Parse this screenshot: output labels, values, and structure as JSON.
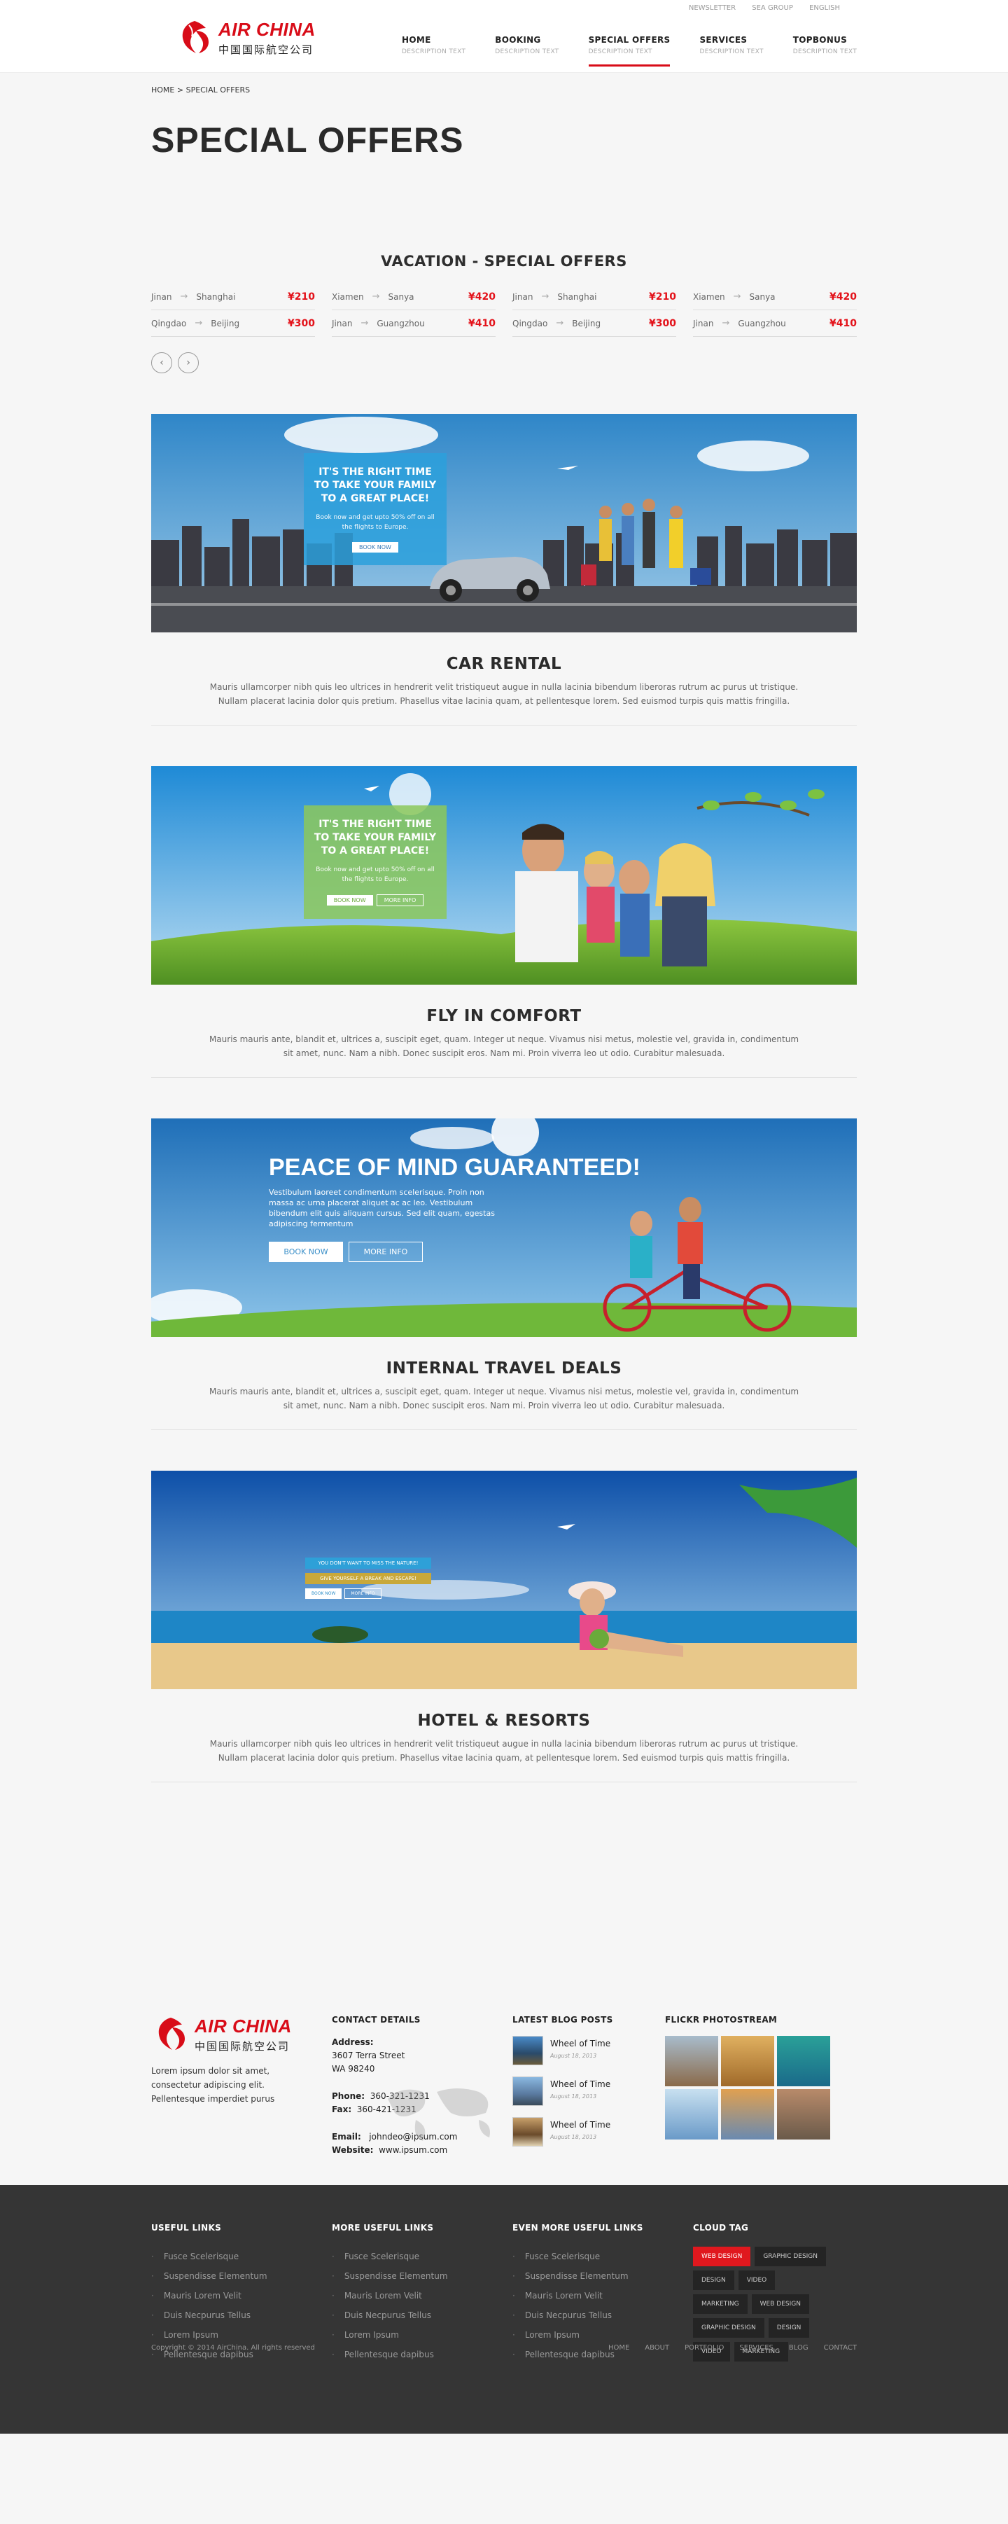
{
  "topbar": {
    "links": [
      "NEWSLETTER",
      "SEA GROUP",
      "ENGLISH"
    ]
  },
  "logo": {
    "en": "AIR CHINA",
    "cn": "中国国际航空公司"
  },
  "nav": [
    {
      "title": "HOME",
      "sub": "DESCRIPTION TEXT"
    },
    {
      "title": "BOOKING",
      "sub": "DESCRIPTION TEXT"
    },
    {
      "title": "SPECIAL OFFERS",
      "sub": "DESCRIPTION TEXT"
    },
    {
      "title": "SERVICES",
      "sub": "DESCRIPTION TEXT"
    },
    {
      "title": "TOPBONUS",
      "sub": "DESCRIPTION TEXT"
    }
  ],
  "breadcrumb": "HOME > SPECIAL OFFERS",
  "page_title": "SPECIAL OFFERS",
  "offers": {
    "title": "VACATION - SPECIAL OFFERS",
    "items": [
      {
        "from": "Jinan",
        "to": "Shanghai",
        "price": "¥210"
      },
      {
        "from": "Xiamen",
        "to": "Sanya",
        "price": "¥420"
      },
      {
        "from": "Jinan",
        "to": "Shanghai",
        "price": "¥210"
      },
      {
        "from": "Xiamen",
        "to": "Sanya",
        "price": "¥420"
      },
      {
        "from": "Qingdao",
        "to": "Beijing",
        "price": "¥300"
      },
      {
        "from": "Jinan",
        "to": "Guangzhou",
        "price": "¥410"
      },
      {
        "from": "Qingdao",
        "to": "Beijing",
        "price": "¥300"
      },
      {
        "from": "Jinan",
        "to": "Guangzhou",
        "price": "¥410"
      }
    ],
    "prev_icon": "‹",
    "next_icon": "›"
  },
  "services": [
    {
      "title": "CAR RENTAL",
      "text": "Mauris ullamcorper nibh quis leo ultrices in hendrerit velit tristiqueut augue in nulla lacinia bibendum liberoras rutrum ac purus ut tristique. Nullam placerat lacinia dolor quis pretium. Phasellus vitae lacinia quam, at pellentesque lorem. Sed euismod turpis quis mattis fringilla.",
      "promo_title": "IT'S THE RIGHT TIME TO TAKE YOUR FAMILY TO A GREAT PLACE!",
      "promo_text": "Book now and get upto 50% off on all the flights to Europe.",
      "promo_button": "BOOK NOW"
    },
    {
      "title": "FLY IN COMFORT",
      "text": "Mauris mauris ante, blandit et, ultrices a, suscipit eget, quam. Integer ut neque. Vivamus nisi metus, molestie vel, gravida in, condimentum sit amet, nunc. Nam a nibh. Donec suscipit eros. Nam mi. Proin viverra leo ut odio. Curabitur malesuada.",
      "promo_title": "IT'S THE RIGHT TIME TO TAKE YOUR FAMILY TO A GREAT PLACE!",
      "promo_text": "Book now and get upto 50% off on all the flights to Europe.",
      "promo_button": "BOOK NOW",
      "promo_button2": "MORE INFO"
    },
    {
      "title": "INTERNAL TRAVEL DEALS",
      "text": "Mauris mauris ante, blandit et, ultrices a, suscipit eget, quam. Integer ut neque. Vivamus nisi metus, molestie vel, gravida in, condimentum sit amet, nunc. Nam a nibh. Donec suscipit eros. Nam mi. Proin viverra leo ut odio. Curabitur malesuada.",
      "promo_title": "PEACE OF MIND GUARANTEED!",
      "promo_text": "Vestibulum laoreet condimentum scelerisque. Proin non massa ac urna placerat aliquet ac ac leo. Vestibulum bibendum elit quis aliquam cursus. Sed elit quam, egestas adipiscing fermentum",
      "promo_button": "BOOK NOW",
      "promo_button2": "MORE INFO"
    },
    {
      "title": "HOTEL & RESORTS",
      "text": "Mauris ullamcorper nibh quis leo ultrices in hendrerit velit tristiqueut augue in nulla lacinia bibendum liberoras rutrum ac purus ut tristique. Nullam placerat lacinia dolor quis pretium. Phasellus vitae lacinia quam, at pellentesque lorem. Sed euismod turpis quis mattis fringilla.",
      "promo_title": "YOU DON'T WANT TO MISS THE NATURE!",
      "promo_text": "GIVE YOURSELF A BREAK AND ESCAPE!",
      "promo_button": "BOOK NOW",
      "promo_button2": "MORE INFO"
    }
  ],
  "footer": {
    "about": "Lorem ipsum dolor sit amet, consectetur adipiscing elit. Pellentesque imperdiet purus",
    "contact": {
      "title": "CONTACT DETAILS",
      "address_label": "Address:",
      "address1": "3607 Terra Street",
      "address2": "WA 98240",
      "phone_label": "Phone:",
      "phone": "360-321-1231",
      "fax_label": "Fax:",
      "fax": "360-421-1231",
      "email_label": "Email:",
      "email": "johndeo@ipsum.com",
      "website_label": "Website:",
      "website": "www.ipsum.com"
    },
    "blog": {
      "title": "LATEST BLOG POSTS",
      "posts": [
        {
          "title": "Wheel of Time",
          "date": "August 18, 2013"
        },
        {
          "title": "Wheel of Time",
          "date": "August 18, 2013"
        },
        {
          "title": "Wheel of Time",
          "date": "August 18, 2013"
        }
      ]
    },
    "flickr": {
      "title": "FLICKR PHOTOSTREAM"
    },
    "links": [
      {
        "title": "USEFUL LINKS",
        "items": [
          "Fusce Scelerisque",
          "Suspendisse Elementum",
          "Mauris Lorem Velit",
          "Duis Necpurus Tellus",
          "Lorem Ipsum",
          "Pellentesque dapibus"
        ]
      },
      {
        "title": "MORE USEFUL LINKS",
        "items": [
          "Fusce Scelerisque",
          "Suspendisse Elementum",
          "Mauris Lorem Velit",
          "Duis Necpurus Tellus",
          "Lorem Ipsum",
          "Pellentesque dapibus"
        ]
      },
      {
        "title": "EVEN MORE USEFUL LINKS",
        "items": [
          "Fusce Scelerisque",
          "Suspendisse Elementum",
          "Mauris Lorem Velit",
          "Duis Necpurus Tellus",
          "Lorem Ipsum",
          "Pellentesque dapibus"
        ]
      }
    ],
    "cloud": {
      "title": "CLOUD TAG",
      "tags": [
        "WEB DESIGN",
        "GRAPHIC DESIGN",
        "DESIGN",
        "VIDEO",
        "MARKETING",
        "WEB DESIGN",
        "GRAPHIC DESIGN",
        "DESIGN",
        "VIDEO",
        "MARKETING"
      ]
    },
    "copyright": "Copyright © 2014 AirChina. All rights reserved",
    "bottom_links": [
      "HOME",
      "ABOUT",
      "PORTFOLIO",
      "SERVICES",
      "BLOG",
      "CONTACT"
    ]
  },
  "colors": {
    "brand_red": "#d80c18",
    "price_red": "#e3121a",
    "footer_dark": "#353535"
  }
}
